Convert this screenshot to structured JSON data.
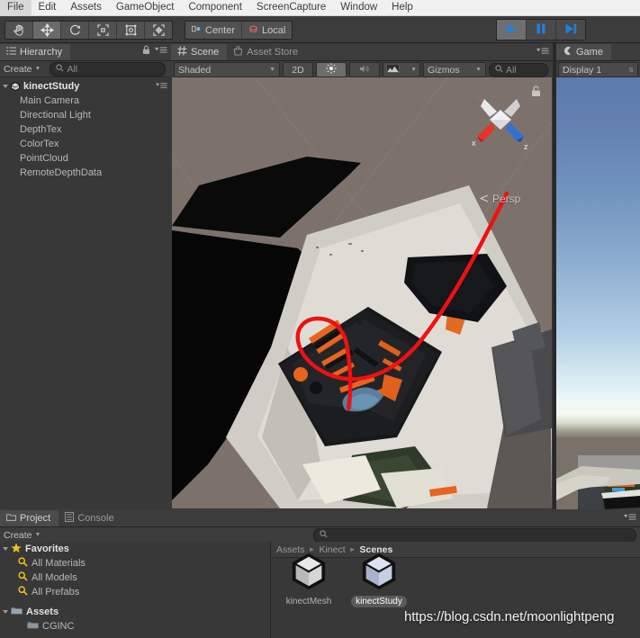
{
  "menubar": {
    "items": [
      {
        "label": "File"
      },
      {
        "label": "Edit"
      },
      {
        "label": "Assets"
      },
      {
        "label": "GameObject"
      },
      {
        "label": "Component"
      },
      {
        "label": "ScreenCapture"
      },
      {
        "label": "Window"
      },
      {
        "label": "Help"
      }
    ]
  },
  "toolbar": {
    "tools": [
      {
        "name": "hand-tool",
        "icon": "hand-icon",
        "active": false
      },
      {
        "name": "move-tool",
        "icon": "move-icon",
        "active": true
      },
      {
        "name": "rotate-tool",
        "icon": "rotate-icon",
        "active": false
      },
      {
        "name": "scale-tool",
        "icon": "scale-icon",
        "active": false
      },
      {
        "name": "rect-tool",
        "icon": "rect-icon",
        "active": false
      },
      {
        "name": "transform-tool",
        "icon": "transform-icon",
        "active": false
      }
    ],
    "pivot_label": "Center",
    "pivot_icon": "pivot-center-icon",
    "rotation_label": "Local",
    "rotation_icon": "rotation-local-icon",
    "play_label": "Play",
    "pause_label": "Pause",
    "step_label": "Step",
    "play_active": true,
    "accent_blue": "#2196f3"
  },
  "hierarchy": {
    "tab_label": "Hierarchy",
    "tab_icon": "hierarchy-icon",
    "create_label": "Create",
    "search_placeholder": "All",
    "search_value": "",
    "scene_name": "kinectStudy",
    "objects": [
      {
        "label": "Main Camera"
      },
      {
        "label": "Directional Light"
      },
      {
        "label": "DepthTex"
      },
      {
        "label": "ColorTex"
      },
      {
        "label": "PointCloud"
      },
      {
        "label": "RemoteDepthData"
      }
    ]
  },
  "scene": {
    "tabs": [
      {
        "label": "Scene",
        "icon": "scene-grid-icon",
        "selected": true
      },
      {
        "label": "Asset Store",
        "icon": "asset-store-icon",
        "selected": false
      }
    ],
    "draw_mode": "Shaded",
    "mode_2d_label": "2D",
    "lighting_icon": "sun-icon",
    "audio_icon": "speaker-icon",
    "fx_icon": "effects-icon",
    "gizmos_label": "Gizmos",
    "search_placeholder": "All",
    "search_value": "",
    "projection_label": "Persp",
    "axis_x_label": "x",
    "axis_z_label": "z",
    "axis_x_color": "#e5342a",
    "axis_z_color": "#2d72d9",
    "background_color": "#7d716b",
    "annotation_color": "#ee1111"
  },
  "game": {
    "tab_label": "Game",
    "tab_icon": "game-icon",
    "display_label": "Display 1"
  },
  "project": {
    "tabs": [
      {
        "label": "Project",
        "icon": "project-folder-icon",
        "selected": true
      },
      {
        "label": "Console",
        "icon": "console-icon",
        "selected": false
      }
    ],
    "create_label": "Create",
    "search_placeholder": "",
    "search_value": "",
    "tree": [
      {
        "label": "Favorites",
        "icon": "star-icon",
        "level": 0,
        "bold": true
      },
      {
        "label": "All Materials",
        "icon": "search-icon",
        "level": 1,
        "bold": false
      },
      {
        "label": "All Models",
        "icon": "search-icon",
        "level": 1,
        "bold": false
      },
      {
        "label": "All Prefabs",
        "icon": "search-icon",
        "level": 1,
        "bold": false
      },
      {
        "label": "Assets",
        "icon": "folder-icon",
        "level": 0,
        "bold": true
      },
      {
        "label": "CGINC",
        "icon": "folder-icon",
        "level": 1,
        "bold": false
      }
    ],
    "breadcrumb": [
      {
        "label": "Assets",
        "current": false
      },
      {
        "label": "Kinect",
        "current": false
      },
      {
        "label": "Scenes",
        "current": true
      }
    ],
    "assets": [
      {
        "label": "kinectMesh",
        "icon": "unity-scene-icon",
        "selected": false
      },
      {
        "label": "kinectStudy",
        "icon": "unity-scene-icon",
        "selected": true
      }
    ]
  },
  "watermark": {
    "text": "https://blog.csdn.net/moonlightpeng"
  }
}
